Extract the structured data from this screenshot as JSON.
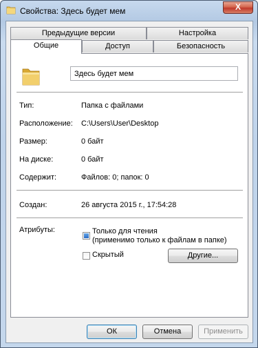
{
  "window": {
    "title": "Свойства: Здесь будет мем",
    "close_glyph": "X"
  },
  "tabs": {
    "row1": [
      "Предыдущие версии",
      "Настройка"
    ],
    "row2": [
      "Общие",
      "Доступ",
      "Безопасность"
    ],
    "active": "Общие"
  },
  "general": {
    "folder_name": "Здесь будет мем",
    "rows": [
      {
        "label": "Тип:",
        "value": "Папка с файлами"
      },
      {
        "label": "Расположение:",
        "value": "C:\\Users\\User\\Desktop"
      },
      {
        "label": "Размер:",
        "value": "0 байт"
      },
      {
        "label": "На диске:",
        "value": "0 байт"
      },
      {
        "label": "Содержит:",
        "value": "Файлов: 0; папок: 0"
      }
    ],
    "created_label": "Создан:",
    "created_value": "26 августа 2015 г., 17:54:28",
    "attributes_label": "Атрибуты:",
    "readonly_label": "Только для чтения",
    "readonly_note": "(применимо только к файлам в папке)",
    "readonly_state": "indeterminate",
    "hidden_label": "Скрытый",
    "hidden_state": "unchecked",
    "other_button": "Другие..."
  },
  "buttons": {
    "ok": "ОК",
    "cancel": "Отмена",
    "apply": "Применить"
  }
}
